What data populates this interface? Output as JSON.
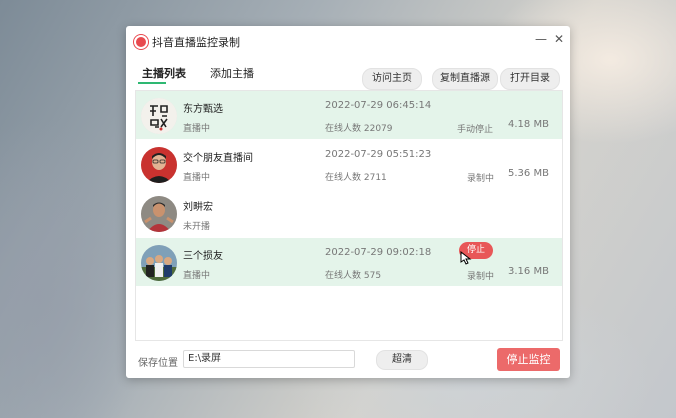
{
  "app": {
    "title": "抖音直播监控录制",
    "min_glyph": "—",
    "close_glyph": "✕"
  },
  "tabs": [
    "主播列表",
    "添加主播"
  ],
  "toolbar": {
    "visit_home": "访问主页",
    "copy_source": "复制直播源",
    "open_dir": "打开目录"
  },
  "streamers": [
    {
      "name": "东方甄选",
      "status": "直播中",
      "time": "2022-07-29 06:45:14",
      "viewers": "在线人数 22079",
      "action": "手动停止",
      "size": "4.18 MB",
      "selected": true
    },
    {
      "name": "交个朋友直播间",
      "status": "直播中",
      "time": "2022-07-29 05:51:23",
      "viewers": "在线人数 2711",
      "action": "录制中",
      "size": "5.36 MB",
      "selected": false
    },
    {
      "name": "刘畊宏",
      "status": "未开播",
      "time": "",
      "viewers": "",
      "action": "",
      "size": "",
      "selected": false
    },
    {
      "name": "三个损友",
      "status": "直播中",
      "time": "2022-07-29 09:02:18",
      "viewers": "在线人数 575",
      "action": "录制中",
      "size": "3.16 MB",
      "selected": true,
      "hover_button": "停止"
    }
  ],
  "footer": {
    "path_label": "保存位置",
    "path_value": "E:\\录屏",
    "browse": "超清",
    "stop_monitor": "停止监控"
  },
  "colors": {
    "accent_green": "#2eb872",
    "selected_row": "#e4f4ea",
    "danger_red": "#ec6a6a"
  }
}
